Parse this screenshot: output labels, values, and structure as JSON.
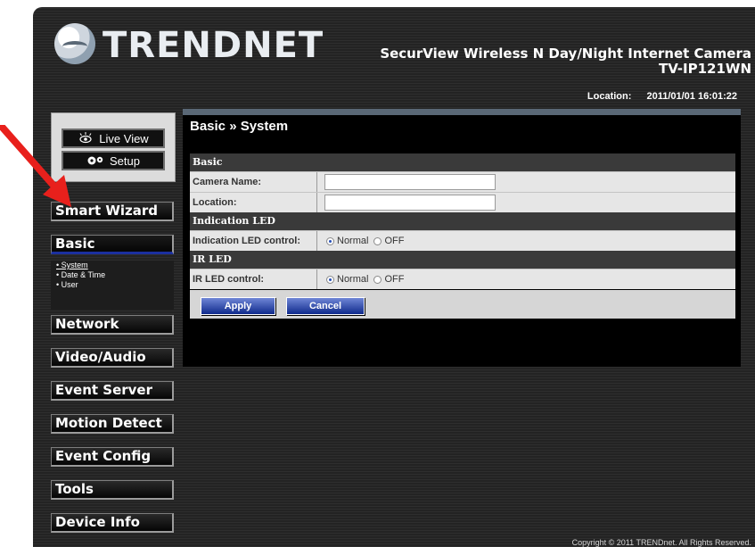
{
  "brand": {
    "logo_text": "TRENDNET"
  },
  "product": {
    "line1": "SecurView Wireless N Day/Night Internet Camera",
    "line2": "TV-IP121WN"
  },
  "location_bar": {
    "label": "Location:",
    "datetime": "2011/01/01 16:01:22"
  },
  "mode_buttons": {
    "live_view": "Live View",
    "setup": "Setup"
  },
  "nav": {
    "smart_wizard": "Smart Wizard",
    "basic": "Basic",
    "basic_sub": [
      "• System",
      "• Date & Time",
      "• User"
    ],
    "network": "Network",
    "video_audio": "Video/Audio",
    "event_server": "Event Server",
    "motion_detect": "Motion Detect",
    "event_config": "Event Config",
    "tools": "Tools",
    "device_info": "Device Info"
  },
  "page": {
    "title": "Basic » System",
    "sections": {
      "basic": "Basic",
      "indication_led": "Indication LED",
      "ir_led": "IR LED"
    },
    "fields": {
      "camera_name": {
        "label": "Camera Name:",
        "value": ""
      },
      "location": {
        "label": "Location:",
        "value": ""
      },
      "indication_led_control": {
        "label": "Indication LED control:",
        "selected": "Normal"
      },
      "ir_led_control": {
        "label": "IR LED control:",
        "selected": "Normal"
      }
    },
    "radio_options": {
      "normal": "Normal",
      "off": "OFF"
    },
    "buttons": {
      "apply": "Apply",
      "cancel": "Cancel"
    }
  },
  "footer": {
    "copyright": "Copyright © 2011 TRENDnet. All Rights Reserved."
  },
  "colors": {
    "accent_blue": "#1b2f9e",
    "annotation_arrow": "#e8201c"
  }
}
